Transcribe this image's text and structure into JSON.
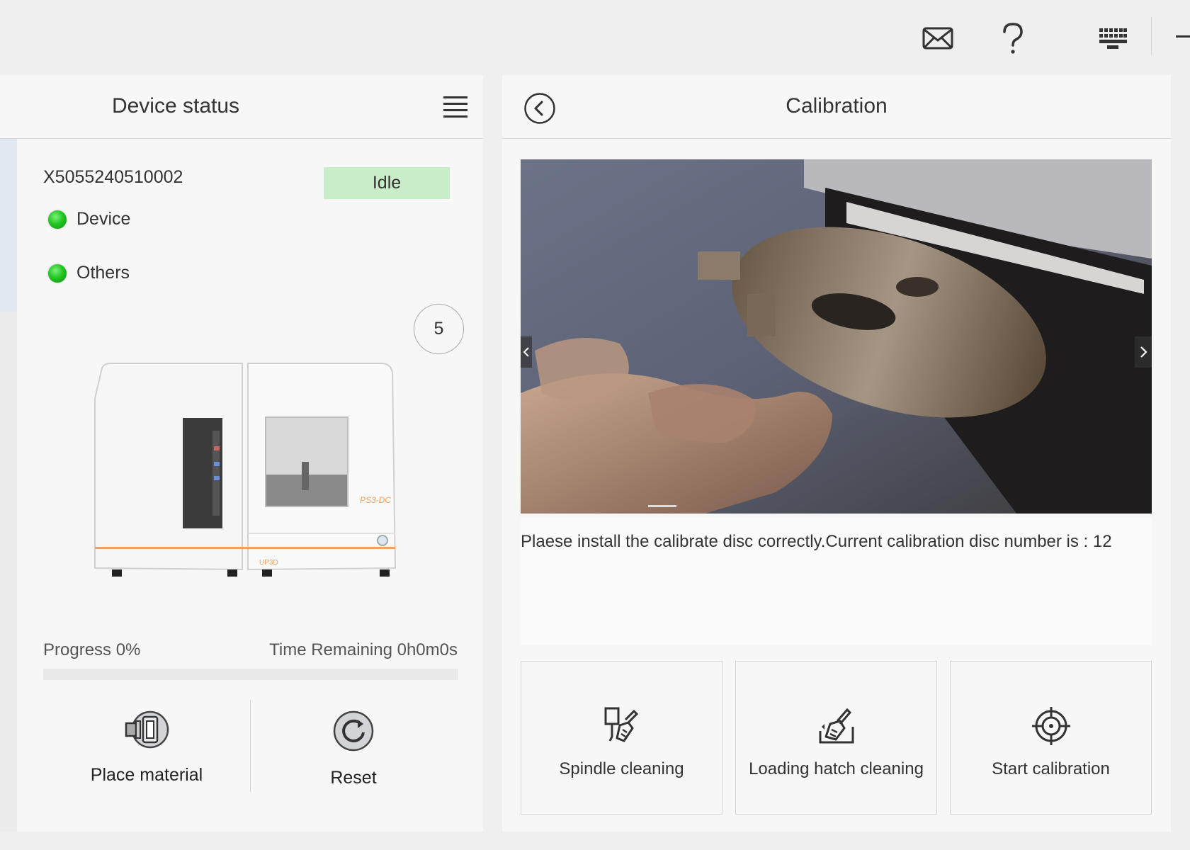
{
  "topbar": {
    "icons": [
      "mail-icon",
      "help-icon",
      "keyboard-icon",
      "minimize-icon"
    ]
  },
  "device_status": {
    "title": "Device status",
    "serial": "X5055240510002",
    "status": "Idle",
    "indicators": [
      {
        "label": "Device",
        "state": "ok"
      },
      {
        "label": "Others",
        "state": "ok"
      }
    ],
    "count": "5",
    "machine_logo": "PS3-DC",
    "machine_brand": "UP3D",
    "progress_label": "Progress 0%",
    "progress_value": 0,
    "time_label": "Time Remaining 0h0m0s",
    "actions": [
      {
        "label": "Place material"
      },
      {
        "label": "Reset"
      }
    ]
  },
  "calibration": {
    "title": "Calibration",
    "instruction": "Plaese install the calibrate disc correctly.Current calibration disc number is : 12",
    "cards": [
      {
        "label": "Spindle cleaning"
      },
      {
        "label": "Loading hatch cleaning"
      },
      {
        "label": "Start calibration"
      }
    ]
  },
  "colors": {
    "idle_badge": "#c9ecc9",
    "indicator_green": "#22c722",
    "panel_bg": "#f7f7f7",
    "page_bg": "#efefef"
  }
}
